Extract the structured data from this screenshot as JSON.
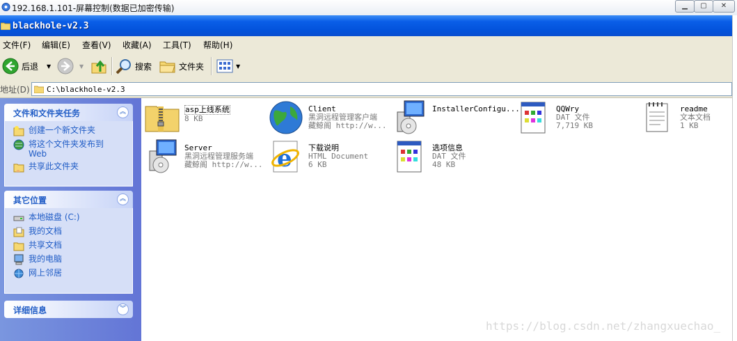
{
  "outer_title": "192.168.1.101-屏幕控制(数据已加密传输)",
  "window_title": "blackhole-v2.3",
  "menu": [
    "文件(F)",
    "编辑(E)",
    "查看(V)",
    "收藏(A)",
    "工具(T)",
    "帮助(H)"
  ],
  "toolbar": {
    "back": "后退",
    "search": "搜索",
    "folders": "文件夹"
  },
  "address": {
    "label": "地址(D)",
    "path": "C:\\blackhole-v2.3"
  },
  "tasks_panel": {
    "title": "文件和文件夹任务",
    "items": [
      "创建一个新文件夹",
      "将这个文件夹发布到 Web",
      "共享此文件夹"
    ]
  },
  "places_panel": {
    "title": "其它位置",
    "items": [
      "本地磁盘 (C:)",
      "我的文档",
      "共享文档",
      "我的电脑",
      "网上邻居"
    ]
  },
  "details_panel": {
    "title": "详细信息"
  },
  "files": [
    {
      "name": "asp上线系统",
      "l2": "8 KB",
      "l3": "",
      "icon": "zip-folder-icon"
    },
    {
      "name": "Client",
      "l2": "黑洞远程管理客户端",
      "l3": "藏鲸阁 http://w...",
      "icon": "globe-icon"
    },
    {
      "name": "InstallerConfigu...",
      "l2": "",
      "l3": "",
      "icon": "installer-icon"
    },
    {
      "name": "QQWry",
      "l2": "DAT 文件",
      "l3": "7,719 KB",
      "icon": "dat-file-icon"
    },
    {
      "name": "readme",
      "l2": "文本文档",
      "l3": "1 KB",
      "icon": "text-file-icon"
    },
    {
      "name": "Server",
      "l2": "黑洞远程管理服务端",
      "l3": "藏鲸阁 http://w...",
      "icon": "installer-icon"
    },
    {
      "name": "下载说明",
      "l2": "HTML Document",
      "l3": "6 KB",
      "icon": "ie-icon"
    },
    {
      "name": "选项信息",
      "l2": "DAT 文件",
      "l3": "48 KB",
      "icon": "dat-file-icon"
    }
  ],
  "watermark": "https://blog.csdn.net/zhangxuechao_",
  "colors": {
    "xp_blue": "#0353dc",
    "pane_blue": "#6f87da",
    "link_blue": "#215dc6"
  }
}
